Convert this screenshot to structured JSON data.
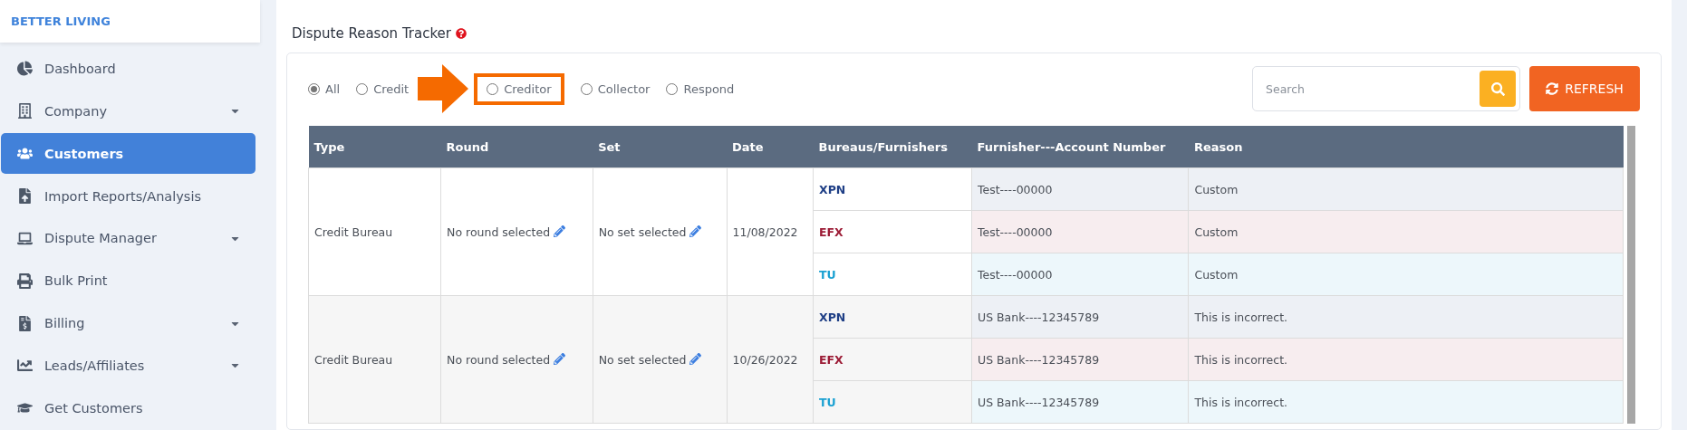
{
  "brand": "BETTER LIVING",
  "sidebar": {
    "items": [
      {
        "label": "Dashboard",
        "selected": false,
        "has_submenu": false
      },
      {
        "label": "Company",
        "selected": false,
        "has_submenu": true
      },
      {
        "label": "Customers",
        "selected": true,
        "has_submenu": false
      },
      {
        "label": "Import Reports/Analysis",
        "selected": false,
        "has_submenu": false
      },
      {
        "label": "Dispute Manager",
        "selected": false,
        "has_submenu": true
      },
      {
        "label": "Bulk Print",
        "selected": false,
        "has_submenu": false
      },
      {
        "label": "Billing",
        "selected": false,
        "has_submenu": true
      },
      {
        "label": "Leads/Affiliates",
        "selected": false,
        "has_submenu": true
      },
      {
        "label": "Get Customers",
        "selected": false,
        "has_submenu": false
      }
    ]
  },
  "panel": {
    "title": "Dispute Reason Tracker",
    "filters": [
      {
        "label": "All",
        "selected": true,
        "highlighted": false
      },
      {
        "label": "Credit",
        "selected": false,
        "highlighted": false
      },
      {
        "label": "Creditor",
        "selected": false,
        "highlighted": true
      },
      {
        "label": "Collector",
        "selected": false,
        "highlighted": false
      },
      {
        "label": "Respond",
        "selected": false,
        "highlighted": false
      }
    ],
    "search": {
      "placeholder": "Search"
    },
    "refresh_button": "REFRESH",
    "table": {
      "columns": [
        "Type",
        "Round",
        "Set",
        "Date",
        "Bureaus/Furnishers",
        "Furnisher---Account Number",
        "Reason"
      ],
      "rows": [
        {
          "type": "Credit Bureau",
          "round": "No round selected",
          "set": "No set selected",
          "date": "11/08/2022",
          "bureaus": [
            {
              "code": "XPN",
              "color": "#1f3f86",
              "account": "Test----00000",
              "reason": "Custom"
            },
            {
              "code": "EFX",
              "color": "#9c1c36",
              "account": "Test----00000",
              "reason": "Custom"
            },
            {
              "code": "TU",
              "color": "#1ba1d2",
              "account": "Test----00000",
              "reason": "Custom"
            }
          ]
        },
        {
          "type": "Credit Bureau",
          "round": "No round selected",
          "set": "No set selected",
          "date": "10/26/2022",
          "bureaus": [
            {
              "code": "XPN",
              "color": "#1f3f86",
              "account": "US Bank----12345789",
              "reason": "This is incorrect."
            },
            {
              "code": "EFX",
              "color": "#9c1c36",
              "account": "US Bank----12345789",
              "reason": "This is incorrect."
            },
            {
              "code": "TU",
              "color": "#1ba1d2",
              "account": "US Bank----12345789",
              "reason": "This is incorrect."
            }
          ]
        }
      ]
    }
  }
}
